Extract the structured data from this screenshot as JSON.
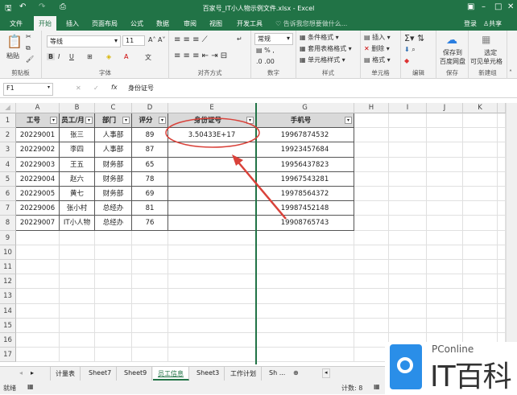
{
  "window": {
    "title": "百家号_IT小人物示例文件.xlsx - Excel"
  },
  "ribbon_tabs": [
    "文件",
    "开始",
    "插入",
    "页面布局",
    "公式",
    "数据",
    "审阅",
    "视图",
    "开发工具"
  ],
  "tell_me": "告诉我您想要做什么...",
  "account": {
    "login": "登录",
    "share": "共享"
  },
  "ribbon": {
    "clipboard": {
      "paste": "粘贴",
      "label": "剪贴板"
    },
    "font": {
      "name": "等线",
      "size": "11",
      "label": "字体"
    },
    "alignment": {
      "label": "对齐方式"
    },
    "number": {
      "format": "常规",
      "label": "数字"
    },
    "styles": {
      "conditional": "条件格式",
      "table": "套用表格格式",
      "cell": "单元格样式",
      "label": "样式"
    },
    "cells": {
      "insert": "插入",
      "delete": "删除",
      "format": "格式",
      "label": "单元格"
    },
    "editing": {
      "label": "编辑"
    },
    "save": {
      "button": "保存到\n百度网盘",
      "line1": "保存到",
      "line2": "百度网盘",
      "label": "保存"
    },
    "newgroup": {
      "line1": "选定",
      "line2": "可见单元格",
      "label": "新建组"
    }
  },
  "formula_bar": {
    "name_box": "F1",
    "formula": "身份证号"
  },
  "columns": [
    "A",
    "B",
    "C",
    "D",
    "E",
    "G",
    "H",
    "I",
    "J",
    "K"
  ],
  "table": {
    "headers": [
      "工号",
      "员工/月",
      "部门",
      "评分",
      "身份证号",
      "手机号"
    ],
    "rows": [
      [
        "20229001",
        "张三",
        "人事部",
        "89",
        "3.50433E+17",
        "19967874532"
      ],
      [
        "20229002",
        "李四",
        "人事部",
        "87",
        "",
        "19923457684"
      ],
      [
        "20229003",
        "王五",
        "财务部",
        "65",
        "",
        "19956437823"
      ],
      [
        "20229004",
        "赵六",
        "财务部",
        "78",
        "",
        "19967543281"
      ],
      [
        "20229005",
        "黄七",
        "财务部",
        "69",
        "",
        "19978564372"
      ],
      [
        "20229006",
        "张小村",
        "总经办",
        "81",
        "",
        "19987452148"
      ],
      [
        "20229007",
        "IT小人物",
        "总经办",
        "76",
        "",
        "19908765743"
      ]
    ]
  },
  "row_numbers": [
    "1",
    "2",
    "3",
    "4",
    "5",
    "6",
    "7",
    "8",
    "9",
    "10",
    "11",
    "12",
    "13",
    "14",
    "15",
    "16",
    "17"
  ],
  "sheet_tabs": [
    "计量表",
    "Sheet7",
    "Sheet9",
    "员工信息",
    "Sheet3",
    "工作计划",
    "Sh ..."
  ],
  "active_sheet": "员工信息",
  "status": {
    "ready": "就绪",
    "count": "计数: 8"
  },
  "watermark": {
    "brand": "PConline",
    "name": "IT百科"
  },
  "colors": {
    "accent": "#217346",
    "annotation": "#d9423a"
  }
}
